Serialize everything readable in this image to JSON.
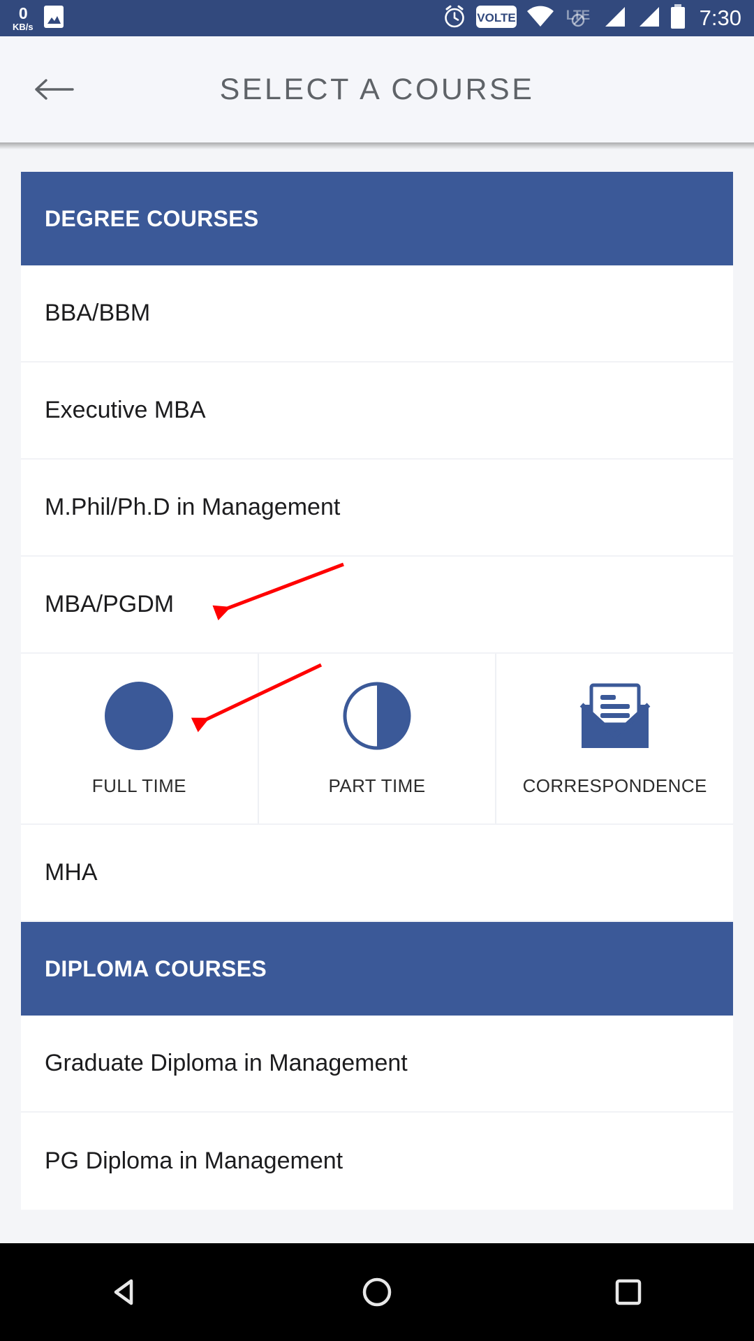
{
  "status_bar": {
    "net_speed_value": "0",
    "net_speed_unit": "KB/s",
    "time": "7:30",
    "icons": [
      "network-speed-icon",
      "screenshot-image-icon",
      "alarm-clock-icon",
      "volte-icon",
      "wifi-icon",
      "lte-disabled-icon",
      "signal-sim1-icon",
      "signal-sim2-icon",
      "battery-icon"
    ],
    "volte_label": "VOLTE",
    "lte_label": "LTE",
    "background_color": "#32497d"
  },
  "app_bar": {
    "back_icon": "arrow-left-icon",
    "title": "SELECT A COURSE",
    "background_color": "#f5f6fa",
    "title_color": "#5f6368"
  },
  "theme": {
    "accent_blue": "#3b5998",
    "page_background": "#f4f5f8",
    "card_background": "#ffffff",
    "divider": "#f1f2f6",
    "annotation_red": "#ff0000"
  },
  "sections": [
    {
      "header": "DEGREE COURSES",
      "items": [
        {
          "label": "BBA/BBM"
        },
        {
          "label": "Executive MBA"
        },
        {
          "label": "M.Phil/Ph.D in Management"
        },
        {
          "label": "MBA/PGDM",
          "expanded": true
        },
        {
          "label": "MHA"
        }
      ]
    },
    {
      "header": "DIPLOMA COURSES",
      "items": [
        {
          "label": "Graduate Diploma in Management"
        },
        {
          "label": "PG Diploma in Management"
        }
      ]
    }
  ],
  "mode_options": [
    {
      "label": "FULL TIME",
      "icon": "full-circle-icon"
    },
    {
      "label": "PART TIME",
      "icon": "half-circle-icon"
    },
    {
      "label": "CORRESPONDENCE",
      "icon": "open-envelope-icon"
    }
  ],
  "annotations": [
    {
      "name": "arrow-to-mba-pgdm",
      "color": "#ff0000"
    },
    {
      "name": "arrow-to-full-time",
      "color": "#ff0000"
    }
  ],
  "nav_bar": {
    "back_label": "back-triangle-icon",
    "home_label": "home-circle-icon",
    "recents_label": "recents-square-icon",
    "background_color": "#000000"
  }
}
